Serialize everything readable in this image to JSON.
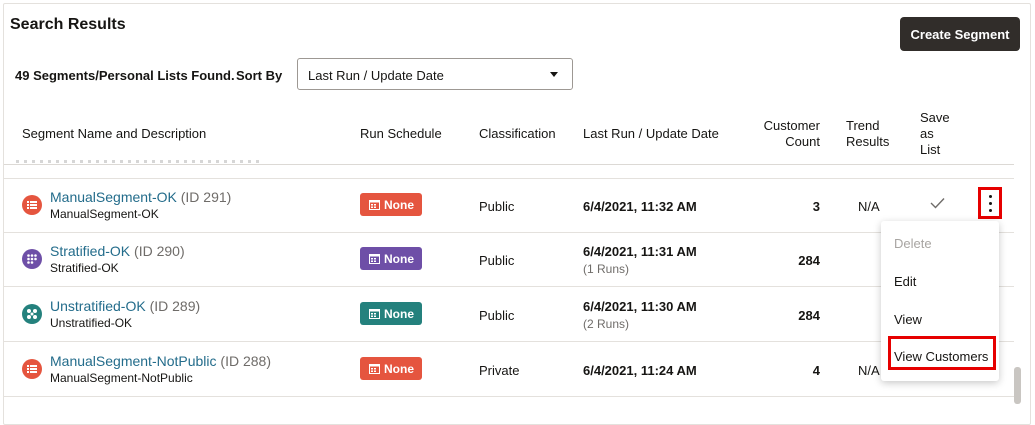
{
  "header": {
    "title": "Search Results",
    "create_label": "Create Segment"
  },
  "summary": {
    "found_text": "49 Segments/Personal Lists Found.",
    "sort_label": "Sort By",
    "sort_value": "Last Run / Update Date"
  },
  "columns": {
    "name": "Segment Name and Description",
    "schedule": "Run Schedule",
    "classification": "Classification",
    "last_run": "Last Run / Update Date",
    "count_1": "Customer",
    "count_2": "Count",
    "trend_1": "Trend",
    "trend_2": "Results",
    "save_1": "Save",
    "save_2": "as",
    "save_3": "List"
  },
  "rows": [
    {
      "name": "ManualSegment-OK",
      "id": "(ID 291)",
      "desc": "ManualSegment-OK",
      "schedule": "None",
      "classification": "Public",
      "last_run": "6/4/2021, 11:32 AM",
      "runs": "",
      "count": "3",
      "trend": "N/A",
      "icon": "list-icon",
      "color": "#e5553f"
    },
    {
      "name": "Stratified-OK",
      "id": "(ID 290)",
      "desc": "Stratified-OK",
      "schedule": "None",
      "classification": "Public",
      "last_run": "6/4/2021, 11:31 AM",
      "runs": "(1 Runs)",
      "count": "284",
      "trend": "",
      "icon": "grid-icon",
      "color": "#6e4fa7"
    },
    {
      "name": "Unstratified-OK",
      "id": "(ID 289)",
      "desc": "Unstratified-OK",
      "schedule": "None",
      "classification": "Public",
      "last_run": "6/4/2021, 11:30 AM",
      "runs": "(2 Runs)",
      "count": "284",
      "trend": "",
      "icon": "cluster-icon",
      "color": "#24817d"
    },
    {
      "name": "ManualSegment-NotPublic",
      "id": "(ID 288)",
      "desc": "ManualSegment-NotPublic",
      "schedule": "None",
      "classification": "Private",
      "last_run": "6/4/2021, 11:24 AM",
      "runs": "",
      "count": "4",
      "trend": "N/A",
      "icon": "list-icon",
      "color": "#e5553f"
    }
  ],
  "menu": {
    "delete": "Delete",
    "edit": "Edit",
    "view": "View",
    "view_customers": "View Customers"
  }
}
